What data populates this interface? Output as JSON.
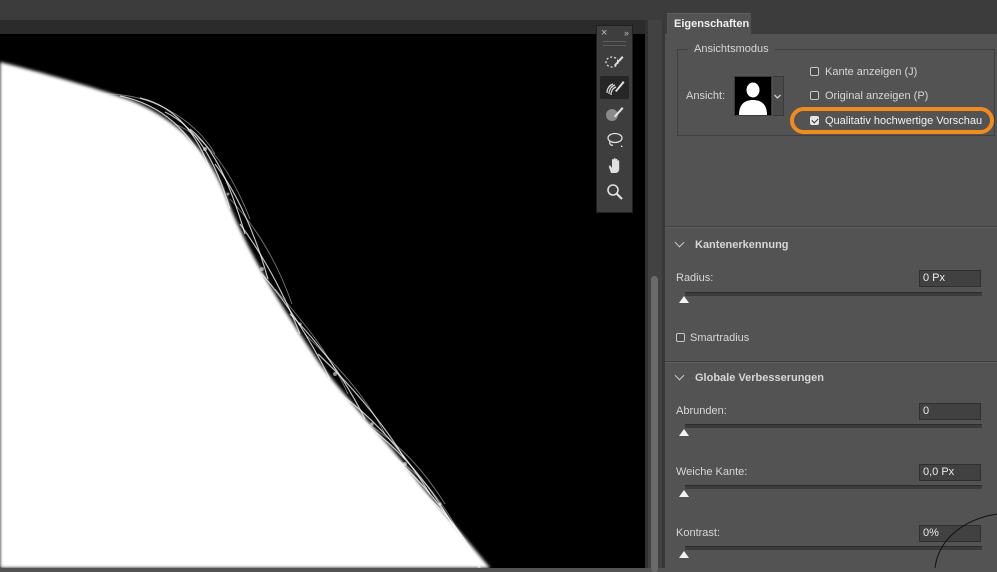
{
  "tools": {
    "close_glyph": "×",
    "collapse_glyph": "››",
    "items": [
      {
        "name": "quick-selection-icon",
        "active": false
      },
      {
        "name": "refine-edge-brush-icon",
        "active": true
      },
      {
        "name": "brush-icon",
        "active": false
      },
      {
        "name": "lasso-icon",
        "active": false
      },
      {
        "name": "hand-icon",
        "active": false
      },
      {
        "name": "zoom-icon",
        "active": false
      }
    ]
  },
  "properties": {
    "tab": "Eigenschaften",
    "ansichtsmodus": {
      "legend": "Ansichtsmodus",
      "view_label": "Ansicht:",
      "kante": {
        "label": "Kante anzeigen (J)",
        "checked": false
      },
      "original": {
        "label": "Original anzeigen (P)",
        "checked": false
      },
      "hq_preview": {
        "label": "Qualitativ hochwertige Vorschau",
        "checked": true
      }
    },
    "kantenerkennung": {
      "title": "Kantenerkennung",
      "radius_label": "Radius:",
      "radius_value": "0 Px",
      "radius_level": 0,
      "smartradius_label": "Smartradius",
      "smartradius_checked": false
    },
    "globale": {
      "title": "Globale Verbesserungen",
      "abrunden_label": "Abrunden:",
      "abrunden_value": "0",
      "abrunden_level": 0,
      "weiche_label": "Weiche Kante:",
      "weiche_value": "0,0 Px",
      "weiche_level": 0,
      "kontrast_label": "Kontrast:",
      "kontrast_value": "0%",
      "kontrast_level": 0
    }
  },
  "colors": {
    "highlight": "#f28b1e",
    "panel": "#535353",
    "canvas": "#000000",
    "mask": "#ffffff"
  }
}
